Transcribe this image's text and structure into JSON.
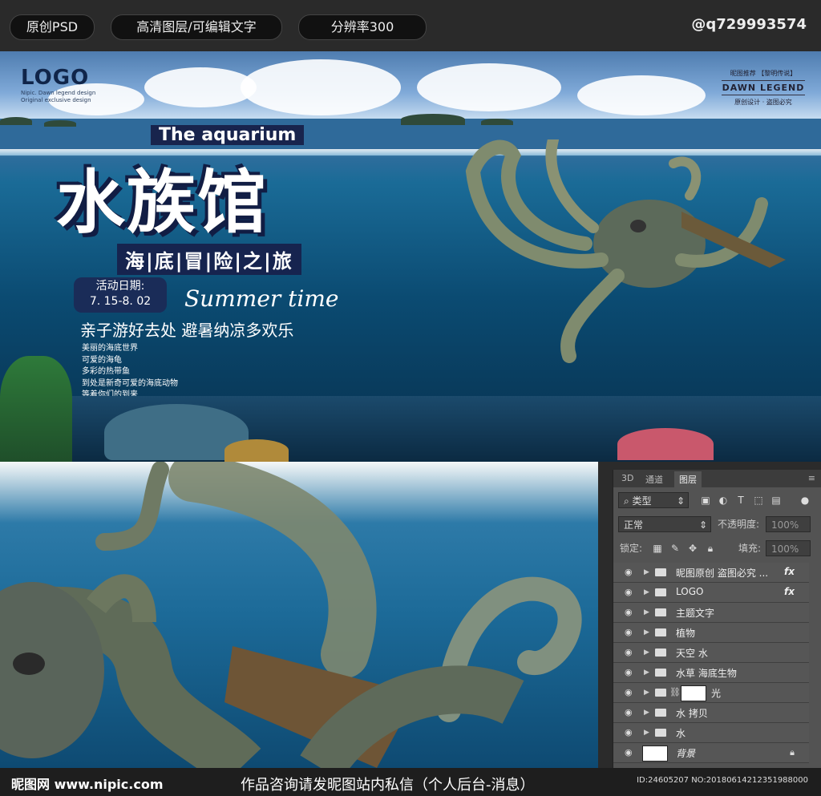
{
  "topbar": {
    "pill1": "原创PSD",
    "pill2": "高清图层/可编辑文字",
    "pill3": "分辨率300",
    "handle": "@q729993574"
  },
  "poster": {
    "logo": "LOGO",
    "logo_sub1": "Nipic. Dawn legend design",
    "logo_sub2": "Original exclusive design",
    "badge_top": "昵图推荐 【黎明传说】",
    "badge_big": "DAWN LEGEND",
    "badge_bottom": "原创设计 · 盗图必究",
    "title_en": "The aquarium",
    "title_cn": "水族馆",
    "subtitle": "海|底|冒|险|之|旅",
    "date_label": "活动日期:",
    "date_value": "7. 15-8. 02",
    "summer": "Summer time",
    "slogan": "亲子游好去处  避暑纳凉多欢乐",
    "features": [
      "美丽的海底世界",
      "可爱的海龟",
      "多彩的热带鱼",
      "到处是新奇可爱的海底动物",
      "等着你们的到来"
    ]
  },
  "ps": {
    "tabs": [
      "3D",
      "通道",
      "图层"
    ],
    "filter_kind": "类型",
    "blend_mode": "正常",
    "opacity_label": "不透明度:",
    "opacity_value": "100%",
    "lock_label": "锁定:",
    "fill_label": "填充:",
    "fill_value": "100%",
    "layers": [
      {
        "name": "昵图原创 盗图必究 ...",
        "fx": "fx"
      },
      {
        "name": "LOGO",
        "fx": "fx"
      },
      {
        "name": "主题文字",
        "fx": ""
      },
      {
        "name": "植物",
        "fx": ""
      },
      {
        "name": "天空 水",
        "fx": ""
      },
      {
        "name": "水草 海底生物",
        "fx": ""
      },
      {
        "name": "光",
        "fx": ""
      },
      {
        "name": "水 拷贝",
        "fx": ""
      },
      {
        "name": "水",
        "fx": ""
      },
      {
        "name": "背景",
        "fx": ""
      }
    ]
  },
  "footer": {
    "brand": "昵图网 www.nipic.com",
    "notice": "作品咨询请发昵图站内私信（个人后台-消息）",
    "id": "ID:24605207 NO:20180614212351988000"
  },
  "colors": {
    "deep_navy": "#16244f",
    "ps_panel": "#535353"
  }
}
